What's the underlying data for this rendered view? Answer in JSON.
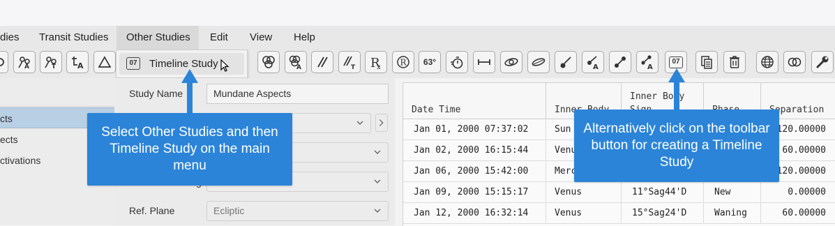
{
  "menu": {
    "items": [
      {
        "label": "dies",
        "active": false
      },
      {
        "label": "Transit Studies",
        "active": false
      },
      {
        "label": "Other Studies",
        "active": true
      },
      {
        "label": "Edit",
        "active": false
      },
      {
        "label": "View",
        "active": false
      },
      {
        "label": "Help",
        "active": false
      }
    ]
  },
  "dropdown": {
    "item_icon_text": "07",
    "item_label": "Timeline Study"
  },
  "toolbar": {
    "degree_button_text": "63°",
    "calendar_button_text": "07",
    "buttons": [
      "mutual-reception-icon",
      "aspect-pattern-icon",
      "aspect-transit-icon",
      "aspect-a-icon",
      "triangle-icon",
      "triple-circle-icon",
      "triple-circle-a-icon",
      "parallel-icon",
      "parallel-t-icon",
      "rx-icon",
      "circle-r-icon",
      "degree-63-button",
      "stopwatch-icon",
      "range-icon",
      "orbit-icon",
      "ellipse-icon",
      "comet-icon",
      "comet-a-icon",
      "dumbbell-icon",
      "dumbbell-a-icon",
      "calendar-07-icon",
      "copy-icon",
      "trash-icon",
      "globe-icon",
      "double-circle-icon",
      "wrench-icon"
    ]
  },
  "left_panel": {
    "items": [
      {
        "label": "cts",
        "selected": true
      },
      {
        "label": "ects",
        "selected": false
      },
      {
        "label": "ctivations",
        "selected": false
      }
    ]
  },
  "form": {
    "study_name_label": "Study Name",
    "study_name_value": "Mundane Aspects",
    "row4_label_fragment": "g",
    "ref_plane_label": "Ref. Plane",
    "ref_plane_value": "Ecliptic"
  },
  "table": {
    "columns": [
      {
        "header_top": "",
        "header_bottom": "Date Time"
      },
      {
        "header_top": "",
        "header_bottom": "Inner Body"
      },
      {
        "header_top": "Inner Body",
        "header_bottom": "Sign"
      },
      {
        "header_top": "",
        "header_bottom": "Phase"
      },
      {
        "header_top": "",
        "header_bottom": "Separation"
      }
    ],
    "rows": [
      [
        "Jan 01, 2000 07:37:02",
        "Sun",
        "",
        "",
        "120.00000"
      ],
      [
        "Jan 02, 2000 16:15:44",
        "Venus",
        "",
        "",
        "60.00000"
      ],
      [
        "Jan 06, 2000 15:42:00",
        "Mercury",
        "",
        "",
        "120.00000"
      ],
      [
        "Jan 09, 2000 15:15:17",
        "Venus",
        "11°Sag44'D",
        "New",
        "0.00000"
      ],
      [
        "Jan 12, 2000 16:32:14",
        "Venus",
        "15°Sag24'D",
        "Waning",
        "60.00000"
      ]
    ]
  },
  "callouts": {
    "left": "Select Other Studies and then Timeline Study on the main menu",
    "right": "Alternatively click on the toolbar button for creating a Timeline Study"
  },
  "colors": {
    "callout_blue": "#2b84d8",
    "selection_blue": "#b9cfe4"
  }
}
